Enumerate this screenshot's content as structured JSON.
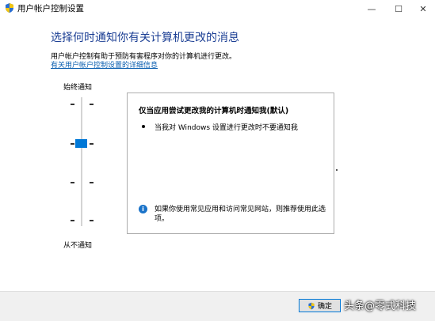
{
  "window": {
    "title": "用户帐户控制设置",
    "min_glyph": "—",
    "max_glyph": "☐",
    "close_glyph": "✕"
  },
  "main": {
    "heading": "选择何时通知你有关计算机更改的消息",
    "description": "用户帐户控制有助于预防有害程序对你的计算机进行更改。",
    "link": "有关用户帐户控制设置的详细信息"
  },
  "slider": {
    "top_label": "始终通知",
    "bottom_label": "从不通知",
    "level_index": 1,
    "level_count": 4
  },
  "panel": {
    "title": "仅当应用尝试更改我的计算机时通知我(默认)",
    "bullet": "当我对 Windows 设置进行更改时不要通知我",
    "note": "如果你使用常见应用和访问常见网站，则推荐使用此选项。",
    "note_icon": "i"
  },
  "footer": {
    "ok_label": "确定"
  },
  "watermark": "头条@零式科技",
  "colors": {
    "accent": "#0078d7",
    "heading": "#1c3f94",
    "link": "#0b5fb0"
  }
}
